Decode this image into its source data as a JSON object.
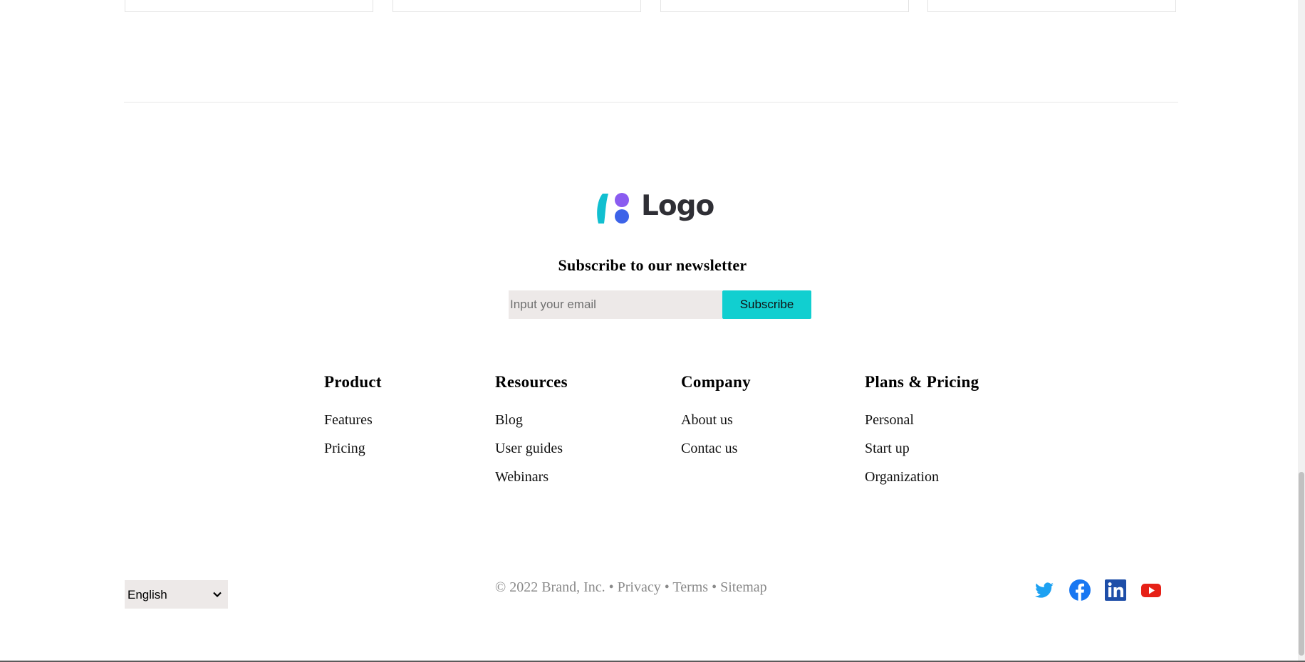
{
  "logo": {
    "text": "Logo"
  },
  "newsletter": {
    "title": "Subscribe to our newsletter",
    "email_placeholder": "Input your email",
    "email_value": "",
    "subscribe_label": "Subscribe"
  },
  "columns": [
    {
      "title": "Product",
      "links": [
        "Features",
        "Pricing"
      ]
    },
    {
      "title": "Resources",
      "links": [
        "Blog",
        "User guides",
        "Webinars"
      ]
    },
    {
      "title": "Company",
      "links": [
        "About us",
        "Contac us"
      ]
    },
    {
      "title": "Plans & Pricing",
      "links": [
        "Personal",
        "Start up",
        "Organization"
      ]
    }
  ],
  "language": {
    "selected": "English"
  },
  "legal": {
    "copyright": "© 2022 Brand, Inc.",
    "separator": "•",
    "privacy": "Privacy",
    "terms": "Terms",
    "sitemap": "Sitemap"
  },
  "social": {
    "twitter_icon": "twitter-icon",
    "facebook_icon": "facebook-icon",
    "linkedin_icon": "linkedin-icon",
    "youtube_icon": "youtube-icon"
  },
  "colors": {
    "accent": "#11cfd0",
    "input_bg": "#ede9e8",
    "muted_text": "#8a8a8a",
    "twitter": "#1da1f2",
    "facebook": "#1877f2",
    "linkedin": "#0a66c2",
    "youtube": "#e62117"
  }
}
